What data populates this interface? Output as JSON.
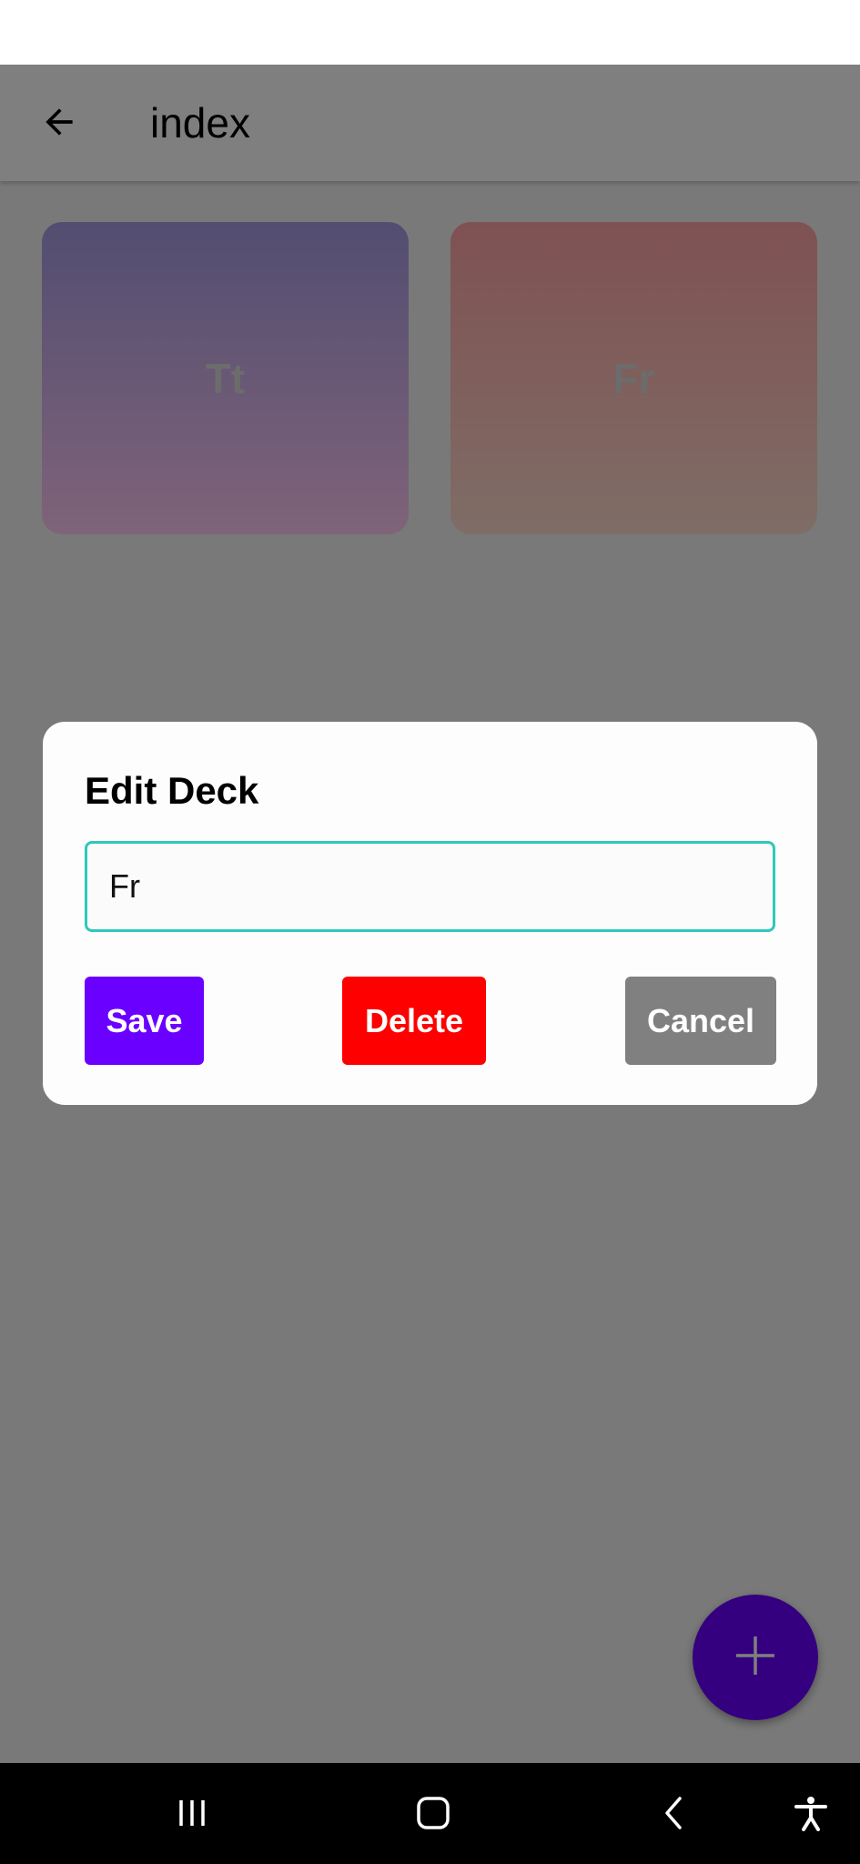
{
  "app_bar": {
    "title": "index",
    "back_icon": "arrow-left-icon"
  },
  "decks": [
    {
      "label": "Tt",
      "gradient_top": "#a59be2",
      "gradient_bottom": "#ffc7f3"
    },
    {
      "label": "Fr",
      "gradient_top": "#ffa3a5",
      "gradient_bottom": "#ffdacd"
    }
  ],
  "fab": {
    "icon": "plus-icon",
    "color": "#6a00ff"
  },
  "dialog": {
    "title": "Edit Deck",
    "input_value": "Fr",
    "buttons": {
      "save": "Save",
      "delete": "Delete",
      "cancel": "Cancel"
    }
  },
  "colors": {
    "primary": "#6a00ff",
    "danger": "#ff0000",
    "neutral": "#808080",
    "input_border": "#2ec9bb"
  },
  "system_nav": {
    "icons": [
      "recent-apps-icon",
      "home-icon",
      "back-icon",
      "accessibility-icon"
    ]
  }
}
